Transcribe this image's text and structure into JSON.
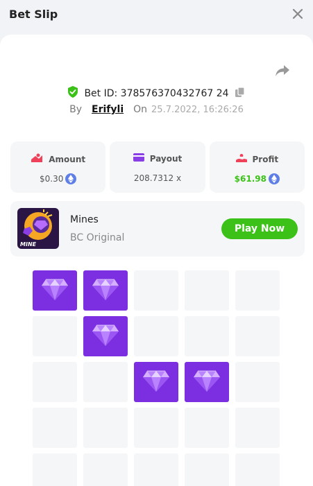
{
  "header": {
    "title": "Bet Slip"
  },
  "bet": {
    "id_label": "Bet ID: 378576370432767 24",
    "by_label": "By",
    "user": "Erifyli",
    "on_label": "On",
    "date": "25.7.2022, 16:26:26"
  },
  "stats": {
    "amount": {
      "label": "Amount",
      "value": "$0.30"
    },
    "payout": {
      "label": "Payout",
      "value": "208.7312 x"
    },
    "profit": {
      "label": "Profit",
      "value": "$61.98"
    }
  },
  "game": {
    "name": "Mines",
    "subtitle": "BC Original",
    "thumb_text": "MINE",
    "play_label": "Play Now"
  },
  "colors": {
    "accent_green": "#3bc117",
    "gem_purple": "#7b2fe0",
    "tile_empty": "#f5f6f8",
    "coin_blue": "#5f7fe6"
  },
  "grid": {
    "rows": 5,
    "cols": 5,
    "gems": [
      [
        0,
        0
      ],
      [
        0,
        1
      ],
      [
        1,
        1
      ],
      [
        2,
        2
      ],
      [
        2,
        3
      ]
    ]
  }
}
